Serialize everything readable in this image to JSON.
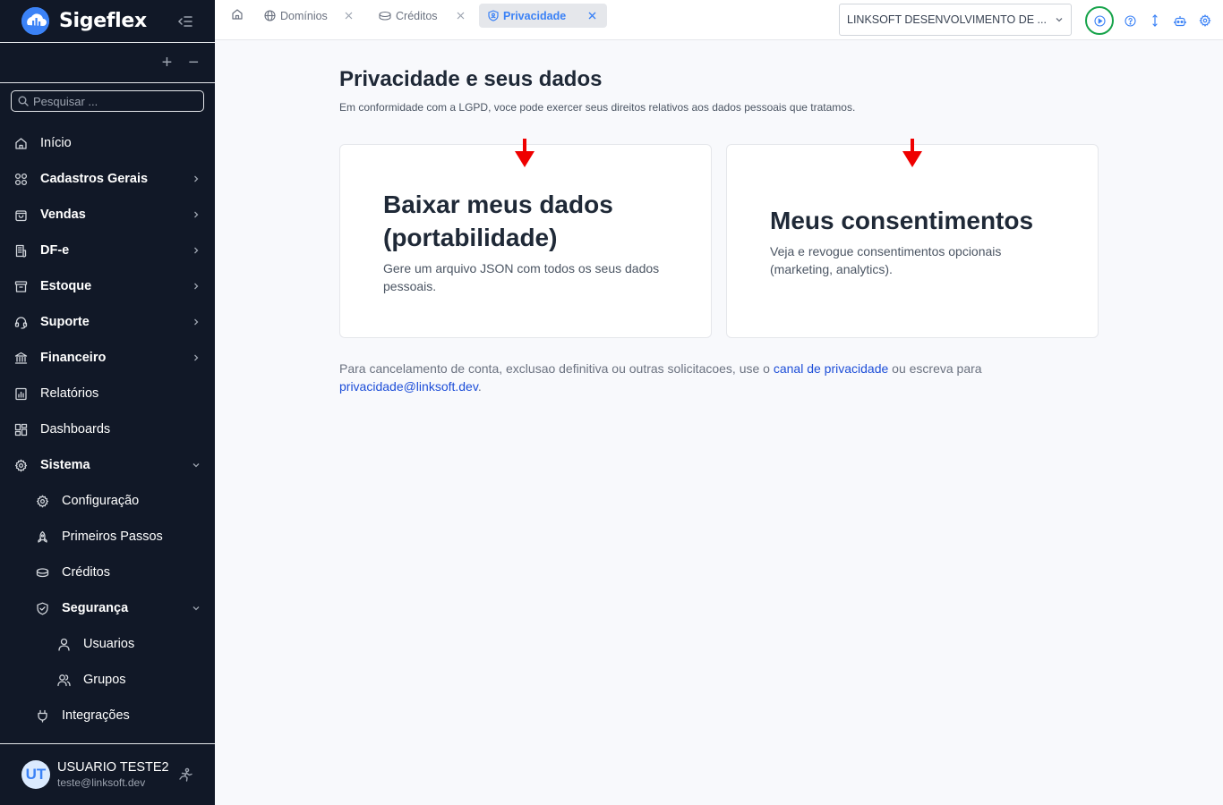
{
  "sidebar": {
    "brand": "Sigeflex",
    "search_placeholder": "Pesquisar ...",
    "expand_all": "+",
    "collapse_all": "−",
    "items": [
      {
        "label": "Início",
        "icon": "home-icon",
        "level": 0,
        "bold": false,
        "chevron": "none"
      },
      {
        "label": "Cadastros Gerais",
        "icon": "grid-icon",
        "level": 0,
        "bold": true,
        "chevron": "right"
      },
      {
        "label": "Vendas",
        "icon": "shopping-bag-icon",
        "level": 0,
        "bold": true,
        "chevron": "right"
      },
      {
        "label": "DF-e",
        "icon": "receipt-icon",
        "level": 0,
        "bold": true,
        "chevron": "right"
      },
      {
        "label": "Estoque",
        "icon": "archive-icon",
        "level": 0,
        "bold": true,
        "chevron": "right"
      },
      {
        "label": "Suporte",
        "icon": "headset-icon",
        "level": 0,
        "bold": true,
        "chevron": "right"
      },
      {
        "label": "Financeiro",
        "icon": "bank-icon",
        "level": 0,
        "bold": true,
        "chevron": "right"
      },
      {
        "label": "Relatórios",
        "icon": "report-icon",
        "level": 0,
        "bold": false,
        "chevron": "none"
      },
      {
        "label": "Dashboards",
        "icon": "dashboard-icon",
        "level": 0,
        "bold": false,
        "chevron": "none"
      },
      {
        "label": "Sistema",
        "icon": "gear-icon",
        "level": 0,
        "bold": true,
        "chevron": "down"
      },
      {
        "label": "Configuração",
        "icon": "gear-icon",
        "level": 1,
        "bold": false,
        "chevron": "none"
      },
      {
        "label": "Primeiros Passos",
        "icon": "rocket-icon",
        "level": 1,
        "bold": false,
        "chevron": "none"
      },
      {
        "label": "Créditos",
        "icon": "coins-icon",
        "level": 1,
        "bold": false,
        "chevron": "none"
      },
      {
        "label": "Segurança",
        "icon": "shield-icon",
        "level": 1,
        "bold": true,
        "chevron": "down"
      },
      {
        "label": "Usuarios",
        "icon": "user-icon",
        "level": 2,
        "bold": false,
        "chevron": "none"
      },
      {
        "label": "Grupos",
        "icon": "users-icon",
        "level": 2,
        "bold": false,
        "chevron": "none"
      },
      {
        "label": "Integrações",
        "icon": "plug-icon",
        "level": 1,
        "bold": false,
        "chevron": "none"
      }
    ],
    "user": {
      "initials": "UT",
      "name": "USUARIO TESTE2",
      "email": "teste@linksoft.dev"
    }
  },
  "topbar": {
    "tabs": [
      {
        "label": "Domínios",
        "icon": "globe-icon",
        "active": false
      },
      {
        "label": "Créditos",
        "icon": "coins-icon",
        "active": false
      },
      {
        "label": "Privacidade",
        "icon": "shield-user-icon",
        "active": true
      }
    ],
    "company": "LINKSOFT DESENVOLVIMENTO DE ..."
  },
  "main": {
    "title": "Privacidade e seus dados",
    "subtitle": "Em conformidade com a LGPD, voce pode exercer seus direitos relativos aos dados pessoais que tratamos.",
    "cards": [
      {
        "title": "Baixar meus dados (portabilidade)",
        "description": "Gere um arquivo JSON com todos os seus dados pessoais."
      },
      {
        "title": "Meus consentimentos",
        "description": "Veja e revogue consentimentos opcionais (marketing, analytics)."
      }
    ],
    "note": {
      "before": "Para cancelamento de conta, exclusao definitiva ou outras solicitacoes, use o ",
      "link_text": "canal de privacidade",
      "middle": " ou escreva para ",
      "email": "privacidade@linksoft.dev",
      "after": "."
    }
  },
  "colors": {
    "sidebar_bg": "#111827",
    "accent": "#3b82f6",
    "link": "#1d4ed8",
    "highlight_ring": "#16a34a",
    "arrow": "#ef0000"
  }
}
